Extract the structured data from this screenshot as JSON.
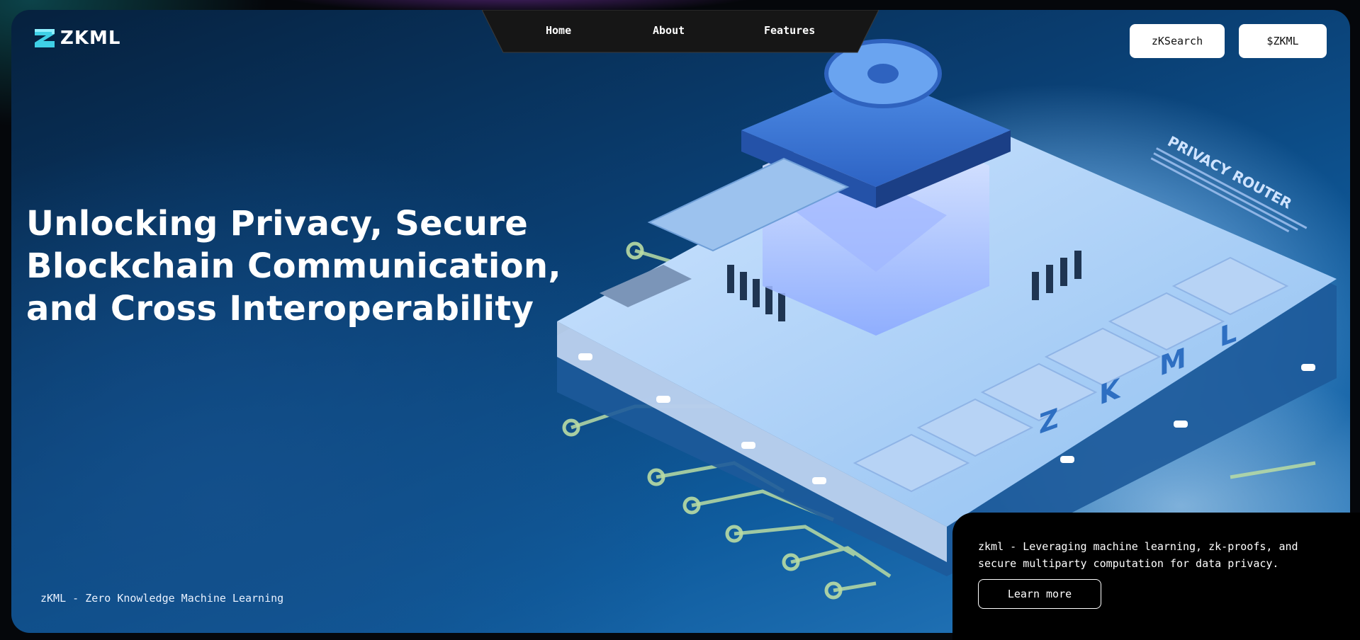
{
  "brand": {
    "name": "ZKML"
  },
  "nav": {
    "links": [
      "Home",
      "About",
      "Features"
    ]
  },
  "actions": {
    "zksearch_label": "zKSearch",
    "token_label": "$ZKML"
  },
  "hero": {
    "headline_lines": [
      "Unlocking Privacy, Secure",
      "Blockchain Communication,",
      "and Cross Interoperability"
    ],
    "tagline": "zKML - Zero Knowledge Machine Learning"
  },
  "info_card": {
    "text": "zkml - Leveraging machine learning, zk-proofs, and secure multiparty computation for data privacy.",
    "button_label": "Learn more"
  },
  "illustration": {
    "chip_letters": [
      "Z",
      "K",
      "M",
      "L"
    ],
    "panel_title": "PRIVACY ROUTER"
  },
  "colors": {
    "accent_cyan": "#3fd0e6",
    "background_dark": "#05070b",
    "hero_blue": "#0f5c9e",
    "nav_bg": "#161616",
    "button_bg": "#ffffff"
  }
}
